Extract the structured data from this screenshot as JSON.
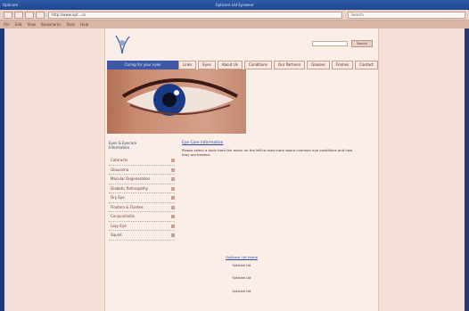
{
  "window": {
    "title": "Opticare Ltd Eyewear",
    "left_label": "Opticare"
  },
  "browser": {
    "url": "http://www.opt...co",
    "search_placeholder": "Search"
  },
  "bookmarks": [
    "File",
    "Edit",
    "View",
    "Bookmarks",
    "Tools",
    "Help"
  ],
  "site": {
    "search_button": "Search",
    "tagline": "Caring for your eyes",
    "nav": [
      "Links",
      "Eyes",
      "About Us",
      "Conditions",
      "Our Partners",
      "Glasses",
      "Frames",
      "Contact"
    ]
  },
  "sidebar": {
    "heading": [
      "Eyes & Eyecare",
      "Information"
    ],
    "items": [
      "Cataracts",
      "Glaucoma",
      "Macular Degeneration",
      "Diabetic Retinopathy",
      "Dry Eye",
      "Floaters & Flashes",
      "Conjunctivitis",
      "Lazy Eye",
      "Squint"
    ]
  },
  "content": {
    "title": "Eye Care Information",
    "text": "Please select a topic from the menu on the left to read more about common eye conditions and how they are treated."
  },
  "footer": {
    "link": "Opticare Ltd Home",
    "lines": [
      "Opticare Ltd",
      "Opticare Ltd",
      "Opticare Ltd"
    ]
  },
  "colors": {
    "viewport_bg": "#f4ded6",
    "page_bg": "#fbeee8",
    "accent_blue": "#3c58a6",
    "link": "#2a48a0"
  }
}
